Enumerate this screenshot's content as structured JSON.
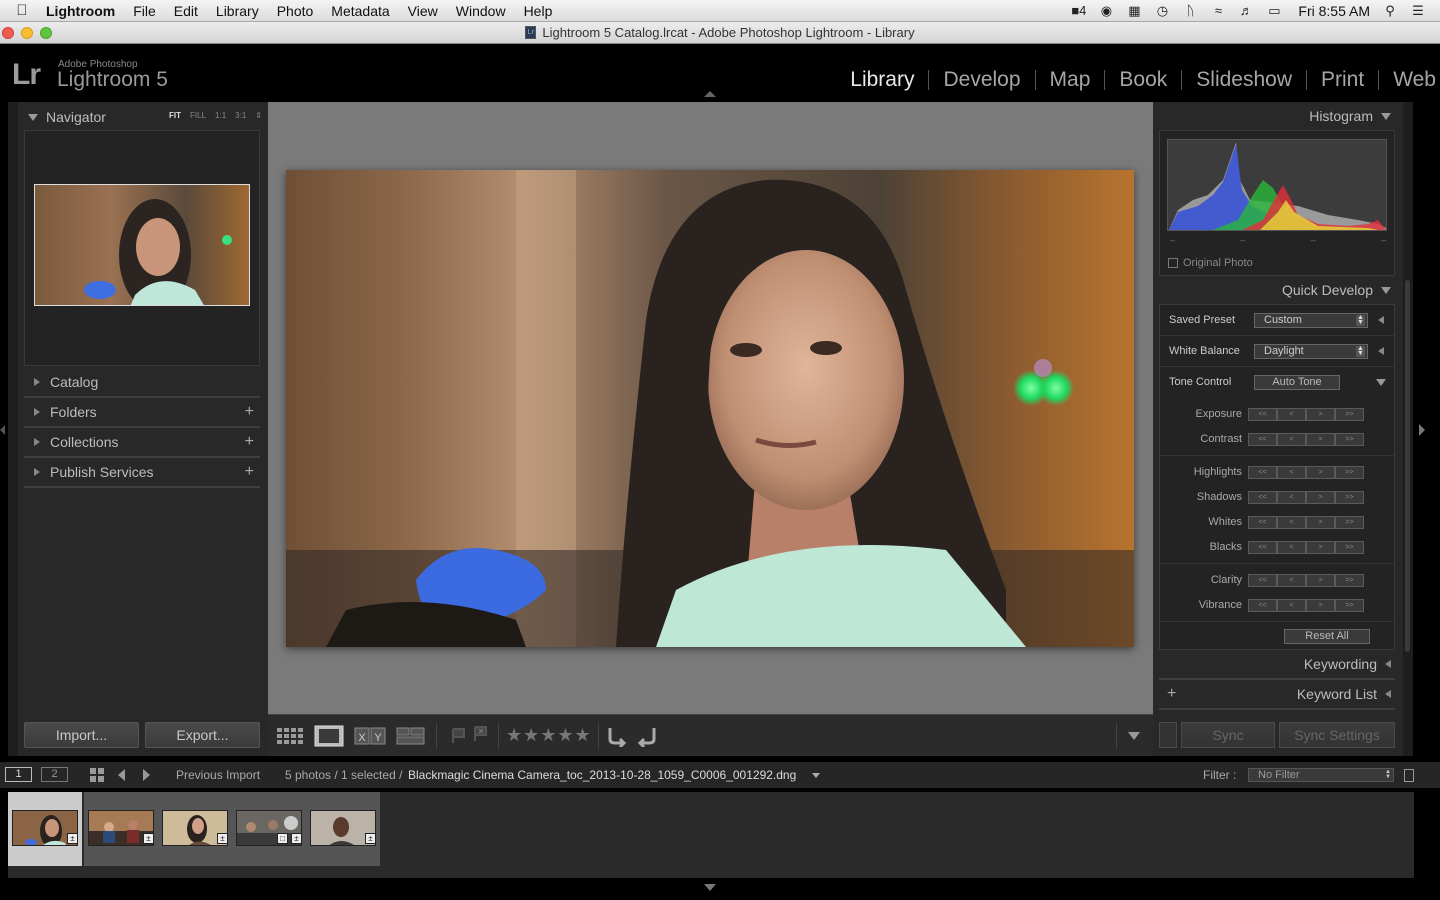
{
  "menubar": {
    "app_name": "Lightroom",
    "items": [
      "File",
      "Edit",
      "Library",
      "Photo",
      "Metadata",
      "View",
      "Window",
      "Help"
    ],
    "tray_badge": "4",
    "clock": "Fri 8:55 AM"
  },
  "window": {
    "title": "Lightroom 5 Catalog.lrcat - Adobe Photoshop Lightroom - Library"
  },
  "identity": {
    "logo": "Lr",
    "adobe": "Adobe Photoshop",
    "product": "Lightroom 5"
  },
  "modules": [
    "Library",
    "Develop",
    "Map",
    "Book",
    "Slideshow",
    "Print",
    "Web"
  ],
  "left_panel": {
    "navigator": {
      "title": "Navigator",
      "zoom": [
        "FIT",
        "FILL",
        "1:1",
        "3:1"
      ]
    },
    "sections": [
      "Catalog",
      "Folders",
      "Collections",
      "Publish Services"
    ],
    "import_label": "Import...",
    "export_label": "Export..."
  },
  "right_panel": {
    "histogram": {
      "title": "Histogram",
      "original_photo": "Original Photo",
      "ticks": [
        "–",
        "–",
        "–",
        "–"
      ]
    },
    "quick_develop": {
      "title": "Quick Develop",
      "saved_preset_label": "Saved Preset",
      "saved_preset_value": "Custom",
      "white_balance_label": "White Balance",
      "white_balance_value": "Daylight",
      "tone_control_label": "Tone Control",
      "auto_tone_label": "Auto Tone",
      "adjustments": [
        "Exposure",
        "Contrast",
        "Highlights",
        "Shadows",
        "Whites",
        "Blacks",
        "Clarity",
        "Vibrance"
      ],
      "adjust_glyphs": [
        "<<",
        "<",
        ">",
        ">>"
      ],
      "reset_all_label": "Reset All"
    },
    "keywording": "Keywording",
    "keyword_list": "Keyword List",
    "sync_label": "Sync",
    "sync_settings_label": "Sync Settings"
  },
  "toolbar": {
    "rating_stars": "★★★★★"
  },
  "filmstrip": {
    "page1": "1",
    "page2": "2",
    "source": "Previous Import",
    "count": "5 photos / 1 selected /",
    "filename": "Blackmagic Cinema Camera_toc_2013-10-28_1059_C0006_001292.dng",
    "filter_label": "Filter :",
    "filter_value": "No Filter"
  },
  "colors": {
    "accent_active": "#e8e8e8",
    "panel_bg": "#282828",
    "canvas_bg": "#7a7a7a"
  }
}
